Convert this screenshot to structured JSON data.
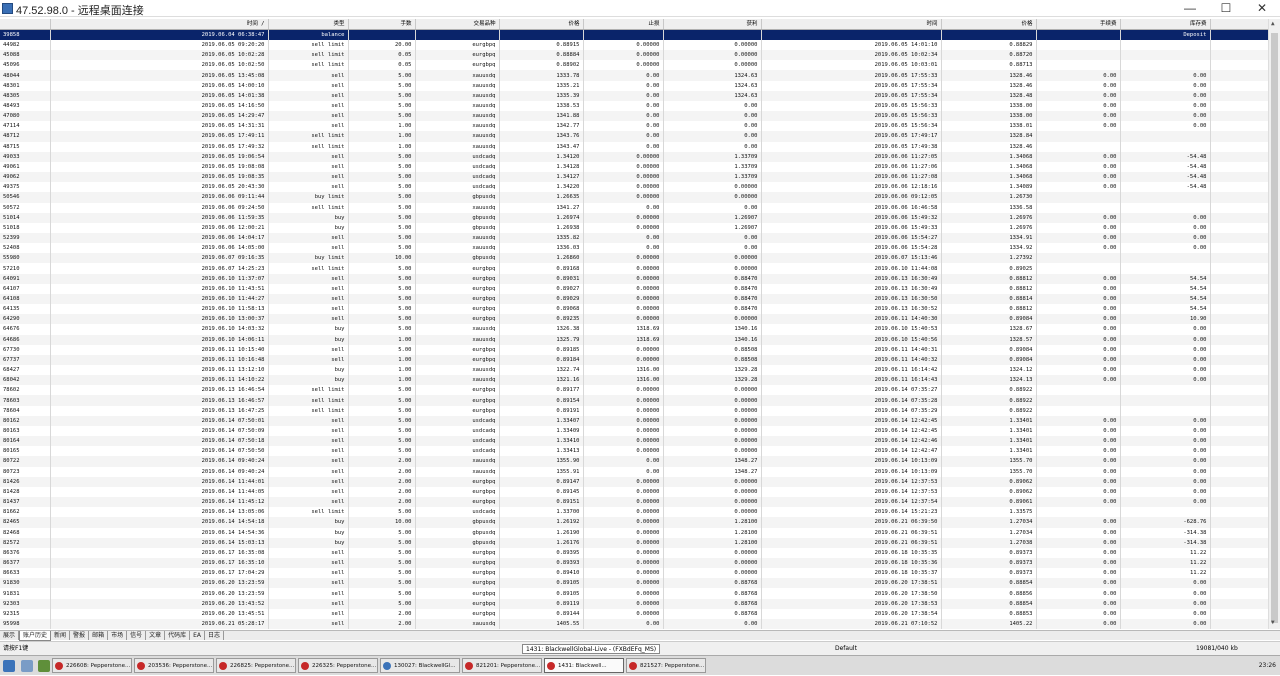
{
  "window": {
    "title": "47.52.98.0 - 远程桌面连接",
    "minimize": "—",
    "maximize": "☐",
    "close": "✕"
  },
  "columns": [
    "",
    "时间 /",
    "类型",
    "手数",
    "交易品种",
    "价格",
    "止损",
    "获利",
    "时间",
    "价格",
    "手续费",
    "库存费",
    "获利"
  ],
  "rows": [
    [
      "39858",
      "2019.06.04 06:38:47",
      "balance",
      "",
      "",
      "",
      "",
      "",
      "",
      "",
      "",
      "Deposit",
      "100 000.00"
    ],
    [
      "44982",
      "2019.06.05 09:20:20",
      "sell limit",
      "20.00",
      "eurgbpq",
      "0.88915",
      "0.00000",
      "0.00000",
      "2019.06.05 14:01:10",
      "0.88829",
      "",
      "",
      ""
    ],
    [
      "45088",
      "2019.06.05 10:02:28",
      "sell limit",
      "0.05",
      "eurgbpq",
      "0.88884",
      "0.00000",
      "0.00000",
      "2019.06.05 10:02:34",
      "0.88720",
      "",
      "",
      ""
    ],
    [
      "45096",
      "2019.06.05 10:02:50",
      "sell limit",
      "0.05",
      "eurgbpq",
      "0.88902",
      "0.00000",
      "0.00000",
      "2019.06.05 10:03:01",
      "0.88713",
      "",
      "",
      ""
    ],
    [
      "48044",
      "2019.06.05 13:45:08",
      "sell",
      "5.00",
      "xauusdq",
      "1333.78",
      "0.00",
      "1324.63",
      "2019.06.05 17:55:33",
      "1328.46",
      "0.00",
      "0.00",
      "2 660.00"
    ],
    [
      "48301",
      "2019.06.05 14:00:10",
      "sell",
      "5.00",
      "xauusdq",
      "1335.21",
      "0.00",
      "1324.63",
      "2019.06.05 17:55:34",
      "1328.46",
      "0.00",
      "0.00",
      "3 375.00"
    ],
    [
      "48305",
      "2019.06.05 14:01:38",
      "sell",
      "5.00",
      "xauusdq",
      "1335.39",
      "0.00",
      "1324.63",
      "2019.06.05 17:55:34",
      "1328.48",
      "0.00",
      "0.00",
      "3 455.00"
    ],
    [
      "48493",
      "2019.06.05 14:16:50",
      "sell",
      "5.00",
      "xauusdq",
      "1338.53",
      "0.00",
      "0.00",
      "2019.06.05 15:56:33",
      "1338.00",
      "0.00",
      "0.00",
      "265.00"
    ],
    [
      "47080",
      "2019.06.05 14:29:47",
      "sell",
      "5.00",
      "xauusdq",
      "1341.88",
      "0.00",
      "0.00",
      "2019.06.05 15:56:33",
      "1338.00",
      "0.00",
      "0.00",
      "1 940.00"
    ],
    [
      "47114",
      "2019.06.05 14:31:31",
      "sell",
      "1.00",
      "xauusdq",
      "1342.77",
      "0.00",
      "0.00",
      "2019.06.05 15:56:34",
      "1338.01",
      "0.00",
      "0.00",
      "476.00"
    ],
    [
      "48712",
      "2019.06.05 17:49:11",
      "sell limit",
      "1.00",
      "xauusdq",
      "1343.76",
      "0.00",
      "0.00",
      "2019.06.05 17:49:17",
      "1328.84",
      "",
      "",
      ""
    ],
    [
      "48715",
      "2019.06.05 17:49:32",
      "sell limit",
      "1.00",
      "xauusdq",
      "1343.47",
      "0.00",
      "0.00",
      "2019.06.05 17:49:38",
      "1328.46",
      "",
      "",
      ""
    ],
    [
      "49033",
      "2019.06.05 19:06:54",
      "sell",
      "5.00",
      "usdcadq",
      "1.34120",
      "0.00000",
      "1.33709",
      "2019.06.06 11:27:05",
      "1.34068",
      "0.00",
      "-54.48",
      "193.93"
    ],
    [
      "49061",
      "2019.06.05 19:08:08",
      "sell",
      "5.00",
      "usdcadq",
      "1.34128",
      "0.00000",
      "1.33709",
      "2019.06.06 11:27:06",
      "1.34068",
      "0.00",
      "-54.48",
      "223.77"
    ],
    [
      "49062",
      "2019.06.05 19:08:35",
      "sell",
      "5.00",
      "usdcadq",
      "1.34127",
      "0.00000",
      "1.33709",
      "2019.06.06 11:27:08",
      "1.34068",
      "0.00",
      "-54.48",
      "220.04"
    ],
    [
      "49375",
      "2019.06.05 20:43:30",
      "sell",
      "5.00",
      "usdcadq",
      "1.34220",
      "0.00000",
      "0.00000",
      "2019.06.06 12:18:16",
      "1.34089",
      "0.00",
      "-54.48",
      "488.48"
    ],
    [
      "50546",
      "2019.06.06 09:11:44",
      "buy limit",
      "5.00",
      "gbpusdq",
      "1.26635",
      "0.00000",
      "0.00000",
      "2019.06.06 09:12:05",
      "1.26730",
      "",
      "",
      ""
    ],
    [
      "50572",
      "2019.06.06 09:24:50",
      "sell limit",
      "5.00",
      "xauusdq",
      "1341.27",
      "0.00",
      "0.00",
      "2019.06.06 16:46:58",
      "1336.58",
      "",
      "",
      ""
    ],
    [
      "51014",
      "2019.06.06 11:59:35",
      "buy",
      "5.00",
      "gbpusdq",
      "1.26974",
      "0.00000",
      "1.26907",
      "2019.06.06 15:49:32",
      "1.26976",
      "0.00",
      "0.00",
      "10.00"
    ],
    [
      "51018",
      "2019.06.06 12:00:21",
      "buy",
      "5.00",
      "gbpusdq",
      "1.26938",
      "0.00000",
      "1.26907",
      "2019.06.06 15:49:33",
      "1.26976",
      "0.00",
      "0.00",
      "190.00"
    ],
    [
      "52399",
      "2019.06.06 14:04:17",
      "sell",
      "5.00",
      "xauusdq",
      "1335.82",
      "0.00",
      "0.00",
      "2019.06.06 15:54:27",
      "1334.91",
      "0.00",
      "0.00",
      "455.00"
    ],
    [
      "52408",
      "2019.06.06 14:05:00",
      "sell",
      "5.00",
      "xauusdq",
      "1336.03",
      "0.00",
      "0.00",
      "2019.06.06 15:54:28",
      "1334.92",
      "0.00",
      "0.00",
      "555.00"
    ],
    [
      "55980",
      "2019.06.07 09:16:35",
      "buy limit",
      "10.00",
      "gbpusdq",
      "1.26860",
      "0.00000",
      "0.00000",
      "2019.06.07 15:13:46",
      "1.27392",
      "",
      "",
      ""
    ],
    [
      "57210",
      "2019.06.07 14:25:23",
      "sell limit",
      "5.00",
      "eurgbpq",
      "0.89168",
      "0.00000",
      "0.00000",
      "2019.06.10 11:44:08",
      "0.89025",
      "",
      "",
      ""
    ],
    [
      "64091",
      "2019.06.10 11:37:07",
      "sell",
      "5.00",
      "eurgbpq",
      "0.89031",
      "0.00000",
      "0.88470",
      "2019.06.13 16:30:49",
      "0.88812",
      "0.00",
      "54.54",
      "1 390.23"
    ],
    [
      "64107",
      "2019.06.10 11:43:51",
      "sell",
      "5.00",
      "eurgbpq",
      "0.89027",
      "0.00000",
      "0.88470",
      "2019.06.13 16:30:49",
      "0.88812",
      "0.00",
      "54.54",
      "1 364.84"
    ],
    [
      "64108",
      "2019.06.10 11:44:27",
      "sell",
      "5.00",
      "eurgbpq",
      "0.89029",
      "0.00000",
      "0.88470",
      "2019.06.13 16:30:50",
      "0.88814",
      "0.00",
      "54.54",
      "1 364.76"
    ],
    [
      "64135",
      "2019.06.10 11:58:13",
      "sell",
      "5.00",
      "eurgbpq",
      "0.89068",
      "0.00000",
      "0.88470",
      "2019.06.13 16:30:52",
      "0.88812",
      "0.00",
      "54.54",
      "1 612.36"
    ],
    [
      "64290",
      "2019.06.10 13:00:37",
      "sell",
      "5.00",
      "eurgbpq",
      "0.89235",
      "0.00000",
      "0.00000",
      "2019.06.11 14:40:30",
      "0.89084",
      "0.00",
      "10.90",
      "958.68"
    ],
    [
      "64676",
      "2019.06.10 14:03:32",
      "buy",
      "5.00",
      "xauusdq",
      "1326.38",
      "1318.69",
      "1340.16",
      "2019.06.10 15:40:53",
      "1328.67",
      "0.00",
      "0.00",
      "1 145.00"
    ],
    [
      "64686",
      "2019.06.10 14:06:11",
      "buy",
      "1.00",
      "xauusdq",
      "1325.79",
      "1318.69",
      "1340.16",
      "2019.06.10 15:40:56",
      "1328.57",
      "0.00",
      "0.00",
      "278.00"
    ],
    [
      "67730",
      "2019.06.11 10:15:40",
      "sell",
      "5.00",
      "eurgbpq",
      "0.89185",
      "0.00000",
      "0.88508",
      "2019.06.11 14:40:31",
      "0.89084",
      "0.00",
      "0.00",
      "641.23"
    ],
    [
      "67737",
      "2019.06.11 10:16:48",
      "sell",
      "1.00",
      "eurgbpq",
      "0.89184",
      "0.00000",
      "0.88508",
      "2019.06.11 14:40:32",
      "0.89084",
      "0.00",
      "0.00",
      "126.98"
    ],
    [
      "68427",
      "2019.06.11 13:12:10",
      "buy",
      "1.00",
      "xauusdq",
      "1322.74",
      "1316.00",
      "1329.28",
      "2019.06.11 16:14:42",
      "1324.12",
      "0.00",
      "0.00",
      "138.00"
    ],
    [
      "68042",
      "2019.06.11 14:10:22",
      "buy",
      "1.00",
      "xauusdq",
      "1321.16",
      "1316.00",
      "1329.28",
      "2019.06.11 16:14:43",
      "1324.13",
      "0.00",
      "0.00",
      "297.00"
    ],
    [
      "78602",
      "2019.06.13 16:46:54",
      "sell limit",
      "5.00",
      "eurgbpq",
      "0.89177",
      "0.00000",
      "0.00000",
      "2019.06.14 07:35:27",
      "0.88922",
      "",
      "",
      ""
    ],
    [
      "78603",
      "2019.06.13 16:46:57",
      "sell limit",
      "5.00",
      "eurgbpq",
      "0.89154",
      "0.00000",
      "0.00000",
      "2019.06.14 07:35:28",
      "0.88922",
      "",
      "",
      ""
    ],
    [
      "78604",
      "2019.06.13 16:47:25",
      "sell limit",
      "5.00",
      "eurgbpq",
      "0.89191",
      "0.00000",
      "0.00000",
      "2019.06.14 07:35:29",
      "0.88922",
      "",
      "",
      ""
    ],
    [
      "80162",
      "2019.06.14 07:50:01",
      "sell",
      "5.00",
      "usdcadq",
      "1.33407",
      "0.00000",
      "0.00000",
      "2019.06.14 12:42:45",
      "1.33401",
      "0.00",
      "0.00",
      "22.49"
    ],
    [
      "80163",
      "2019.06.14 07:50:09",
      "sell",
      "5.00",
      "usdcadq",
      "1.33409",
      "0.00000",
      "0.00000",
      "2019.06.14 12:42:45",
      "1.33401",
      "0.00",
      "0.00",
      "29.98"
    ],
    [
      "80164",
      "2019.06.14 07:50:18",
      "sell",
      "5.00",
      "usdcadq",
      "1.33410",
      "0.00000",
      "0.00000",
      "2019.06.14 12:42:46",
      "1.33401",
      "0.00",
      "0.00",
      "33.73"
    ],
    [
      "80165",
      "2019.06.14 07:50:50",
      "sell",
      "5.00",
      "usdcadq",
      "1.33413",
      "0.00000",
      "0.00000",
      "2019.06.14 12:42:47",
      "1.33401",
      "0.00",
      "0.00",
      "44.98"
    ],
    [
      "80722",
      "2019.06.14 09:40:24",
      "sell",
      "2.00",
      "xauusdq",
      "1355.90",
      "0.00",
      "1348.27",
      "2019.06.14 10:13:09",
      "1355.70",
      "0.00",
      "0.00",
      "40.00"
    ],
    [
      "80723",
      "2019.06.14 09:40:24",
      "sell",
      "2.00",
      "xauusdq",
      "1355.91",
      "0.00",
      "1348.27",
      "2019.06.14 10:13:09",
      "1355.70",
      "0.00",
      "0.00",
      "42.00"
    ],
    [
      "81426",
      "2019.06.14 11:44:01",
      "sell",
      "2.00",
      "eurgbpq",
      "0.89147",
      "0.00000",
      "0.00000",
      "2019.06.14 12:37:53",
      "0.89062",
      "0.00",
      "0.00",
      "215.11"
    ],
    [
      "81428",
      "2019.06.14 11:44:05",
      "sell",
      "2.00",
      "eurgbpq",
      "0.89145",
      "0.00000",
      "0.00000",
      "2019.06.14 12:37:53",
      "0.89062",
      "0.00",
      "0.00",
      "210.05"
    ],
    [
      "81437",
      "2019.06.14 11:45:12",
      "sell",
      "2.00",
      "eurgbpq",
      "0.89151",
      "0.00000",
      "0.00000",
      "2019.06.14 12:37:54",
      "0.89061",
      "0.00",
      "0.00",
      "227.76"
    ],
    [
      "81662",
      "2019.06.14 13:05:06",
      "sell limit",
      "5.00",
      "usdcadq",
      "1.33700",
      "0.00000",
      "0.00000",
      "2019.06.14 15:21:23",
      "1.33575",
      "",
      "",
      ""
    ],
    [
      "82465",
      "2019.06.14 14:54:18",
      "buy",
      "10.00",
      "gbpusdq",
      "1.26192",
      "0.00000",
      "1.28100",
      "2019.06.21 06:39:50",
      "1.27034",
      "0.00",
      "-628.76",
      "8 420.00"
    ],
    [
      "82468",
      "2019.06.14 14:54:36",
      "buy",
      "5.00",
      "gbpusdq",
      "1.26190",
      "0.00000",
      "1.28100",
      "2019.06.21 06:39:51",
      "1.27034",
      "0.00",
      "-314.38",
      "4 220.00"
    ],
    [
      "82572",
      "2019.06.14 15:03:13",
      "buy",
      "5.00",
      "gbpusdq",
      "1.26176",
      "0.00000",
      "1.28100",
      "2019.06.21 06:39:51",
      "1.27038",
      "0.00",
      "-314.38",
      "4 310.00"
    ],
    [
      "86376",
      "2019.06.17 16:35:08",
      "sell",
      "5.00",
      "eurgbpq",
      "0.89395",
      "0.00000",
      "0.00000",
      "2019.06.18 10:35:35",
      "0.89373",
      "0.00",
      "11.22",
      "137.77"
    ],
    [
      "86377",
      "2019.06.17 16:35:10",
      "sell",
      "5.00",
      "eurgbpq",
      "0.89393",
      "0.00000",
      "0.00000",
      "2019.06.18 10:35:36",
      "0.89373",
      "0.00",
      "11.22",
      "125.24"
    ],
    [
      "86633",
      "2019.06.17 17:04:29",
      "sell",
      "5.00",
      "eurgbpq",
      "0.89410",
      "0.00000",
      "0.00000",
      "2019.06.18 10:35:37",
      "0.89373",
      "0.00",
      "11.22",
      "231.70"
    ],
    [
      "91830",
      "2019.06.20 13:23:59",
      "sell",
      "5.00",
      "eurgbpq",
      "0.89105",
      "0.00000",
      "0.88768",
      "2019.06.20 17:38:51",
      "0.88854",
      "0.00",
      "0.00",
      "1 593.18"
    ],
    [
      "91831",
      "2019.06.20 13:23:59",
      "sell",
      "5.00",
      "eurgbpq",
      "0.89105",
      "0.00000",
      "0.88768",
      "2019.06.20 17:38:50",
      "0.88856",
      "0.00",
      "0.00",
      "1 580.44"
    ],
    [
      "92303",
      "2019.06.20 13:43:52",
      "sell",
      "5.00",
      "eurgbpq",
      "0.89119",
      "0.00000",
      "0.88768",
      "2019.06.20 17:38:53",
      "0.88854",
      "0.00",
      "0.00",
      "1 682.04"
    ],
    [
      "92315",
      "2019.06.20 13:45:51",
      "sell",
      "2.00",
      "eurgbpq",
      "0.89144",
      "0.00000",
      "0.88768",
      "2019.06.20 17:38:54",
      "0.88853",
      "0.00",
      "0.00",
      "738.84"
    ],
    [
      "95998",
      "2019.06.21 05:28:17",
      "sell",
      "2.00",
      "xauusdq",
      "1405.55",
      "0.00",
      "0.00",
      "2019.06.21 07:10:52",
      "1405.22",
      "0.00",
      "0.00",
      "66.00"
    ]
  ],
  "tabs": [
    "展示",
    "账户历史",
    "新闻",
    "警报",
    "邮箱",
    "市场",
    "信号",
    "文章",
    "代码库",
    "EA",
    "日志"
  ],
  "active_tab": 1,
  "status": {
    "help": "请按F1键",
    "server": "1431: BlackwellGlobal-Live - (FXBdEFq_MS)",
    "profile": "Default",
    "traffic": "19081/040 kb"
  },
  "taskbar": {
    "tasks": [
      "226608: Pepperstone...",
      "203536: Pepperstone...",
      "226825: Pepperstone...",
      "226325: Pepperstone...",
      "130027: BlackwellGl...",
      "821201: Pepperstone...",
      "1431: Blackwell...",
      "821527: Pepperstone..."
    ],
    "active_task": 6,
    "clock": "23:26"
  },
  "colors": {
    "selected_row": "#0a246a"
  }
}
